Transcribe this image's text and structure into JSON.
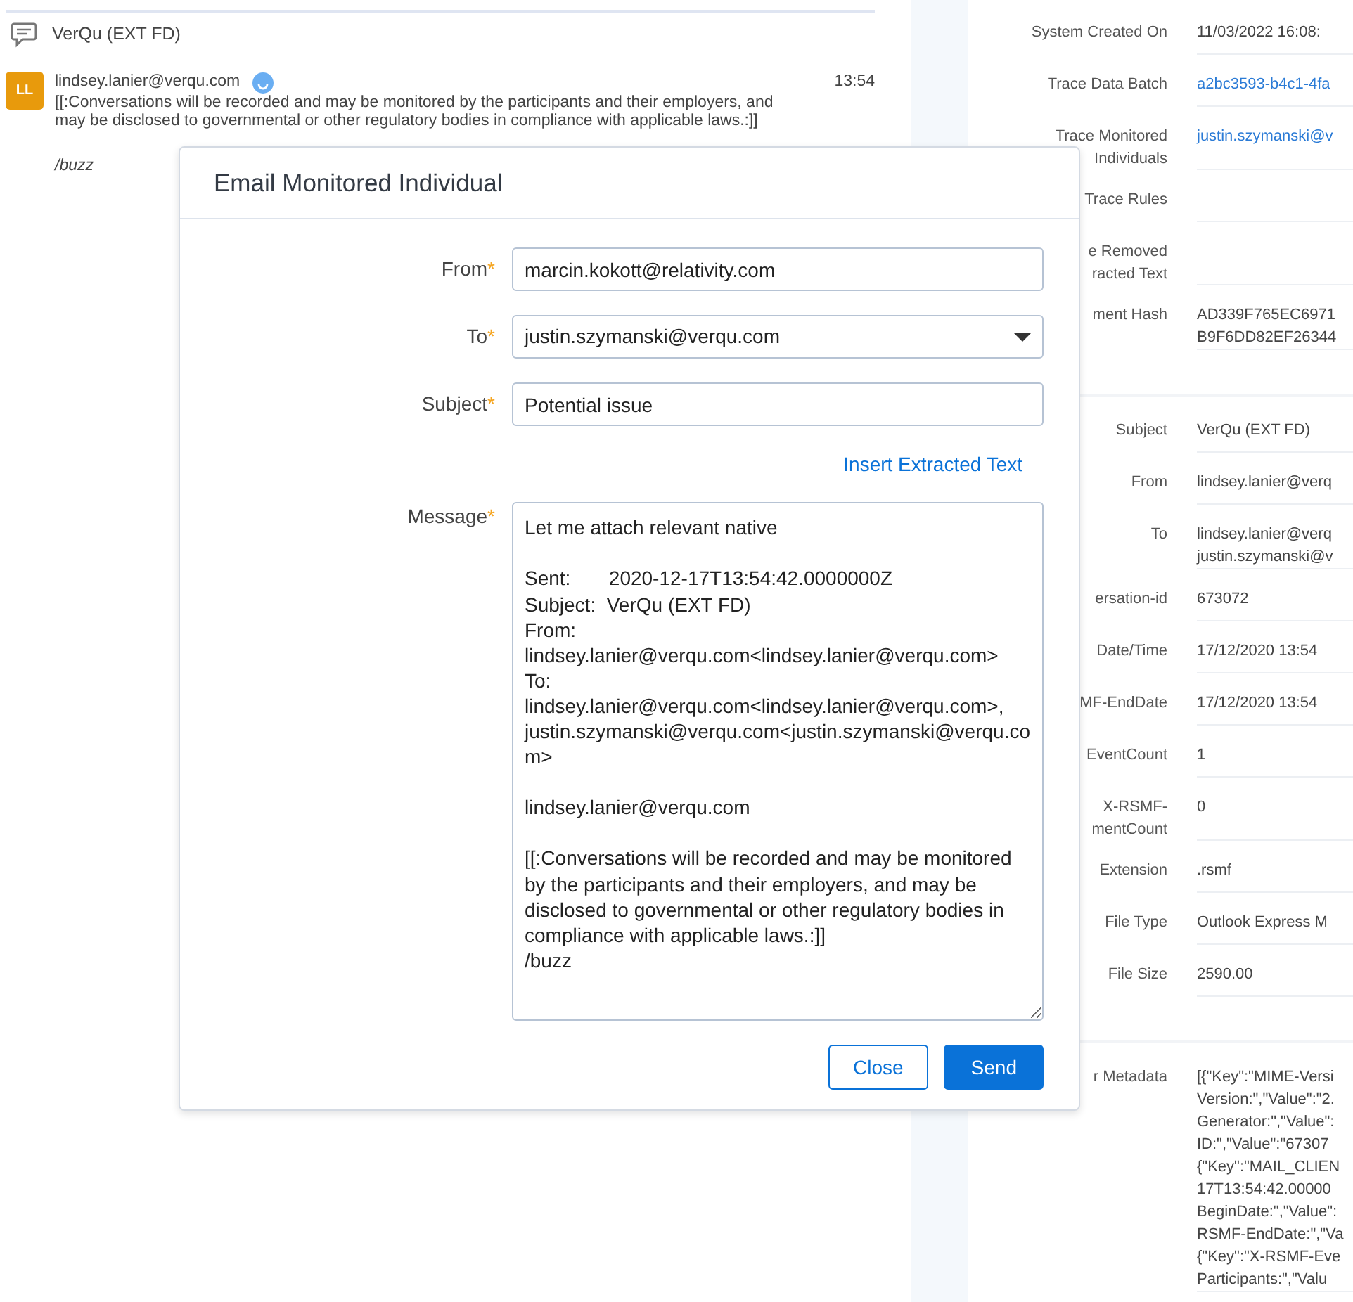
{
  "chat": {
    "conversation_title": "VerQu (EXT FD)",
    "message": {
      "avatar_initials": "LL",
      "sender": "lindsey.lanier@verqu.com",
      "time": "13:54",
      "lines": [
        "[[:Conversations will be recorded and may be monitored by the participants and their employers, and",
        "may be disclosed to governmental or other regulatory bodies in compliance with applicable laws.:]]"
      ],
      "footer": "/buzz"
    }
  },
  "details": {
    "sections": [
      {
        "rows": [
          {
            "label": "System Created On",
            "value": "11/03/2022 16:08:",
            "kind": "plain"
          },
          {
            "label": "Trace Data Batch",
            "value": "a2bc3593-b4c1-4fa",
            "kind": "link"
          },
          {
            "label": "Trace Monitored\nIndividuals",
            "value": "justin.szymanski@v",
            "kind": "link"
          },
          {
            "label": "Trace Rules",
            "kind": "plain"
          },
          {
            "label": "e Removed\nracted Text",
            "kind": "plain"
          },
          {
            "label": "ment Hash",
            "value": "AD339F765EC6971\nB9F6DD82EF26344",
            "kind": "plain"
          }
        ]
      },
      {
        "rows": [
          {
            "label": "Subject",
            "value": "VerQu (EXT FD)",
            "kind": "plain"
          },
          {
            "label": "From",
            "value": "lindsey.lanier@verq",
            "kind": "plain"
          },
          {
            "label": "To",
            "value": "lindsey.lanier@verq\njustin.szymanski@v",
            "kind": "plain"
          },
          {
            "label": "ersation-id",
            "value": "673072",
            "kind": "plain"
          },
          {
            "label": "Date/Time",
            "value": "17/12/2020 13:54",
            "kind": "plain"
          },
          {
            "label": "MF-EndDate",
            "value": "17/12/2020 13:54",
            "kind": "plain"
          },
          {
            "label": "EventCount",
            "value": "1",
            "kind": "plain"
          },
          {
            "label": "X-RSMF-\nmentCount",
            "value": "0",
            "kind": "plain"
          },
          {
            "label": "Extension",
            "value": ".rsmf",
            "kind": "plain"
          },
          {
            "label": "File Type",
            "value": "Outlook Express M",
            "kind": "plain"
          },
          {
            "label": "File Size",
            "value": "2590.00",
            "kind": "plain"
          }
        ]
      },
      {
        "rows": [
          {
            "label": "r Metadata",
            "value": "[{\"Key\":\"MIME-Versi\nVersion:\",\"Value\":\"2.\nGenerator:\",\"Value\":\nID:\",\"Value\":\"67307\n{\"Key\":\"MAIL_CLIEN\n17T13:54:42.00000\nBeginDate:\",\"Value\":\nRSMF-EndDate:\",\"Va\n{\"Key\":\"X-RSMF-Eve\nParticipants:\",\"Valu",
            "kind": "plain"
          }
        ]
      }
    ]
  },
  "dialog": {
    "title": "Email Monitored Individual",
    "fields": [
      {
        "label": "From",
        "required_mark": "*",
        "value": "marcin.kokott@relativity.com",
        "kind": "text"
      },
      {
        "label": "To",
        "required_mark": "*",
        "value": "justin.szymanski@verqu.com",
        "kind": "select"
      },
      {
        "label": "Subject",
        "required_mark": "*",
        "value": "Potential issue",
        "kind": "text"
      }
    ],
    "insert_link": "Insert Extracted Text",
    "message": {
      "label": "Message",
      "required_mark": "*",
      "value": "Let me attach relevant native\n\nSent:       2020-12-17T13:54:42.0000000Z\nSubject:  VerQu (EXT FD)\nFrom:\nlindsey.lanier@verqu.com<lindsey.lanier@verqu.com>\nTo:\nlindsey.lanier@verqu.com<lindsey.lanier@verqu.com>,\njustin.szymanski@verqu.com<justin.szymanski@verqu.com>\n\nlindsey.lanier@verqu.com\n\n[[:Conversations will be recorded and may be monitored by the participants and their employers, and may be disclosed to governmental or other regulatory bodies in compliance with applicable laws.:]]\n/buzz"
    },
    "buttons": [
      {
        "label": "Close",
        "kind": "secondary"
      },
      {
        "label": "Send",
        "kind": "primary"
      }
    ]
  }
}
